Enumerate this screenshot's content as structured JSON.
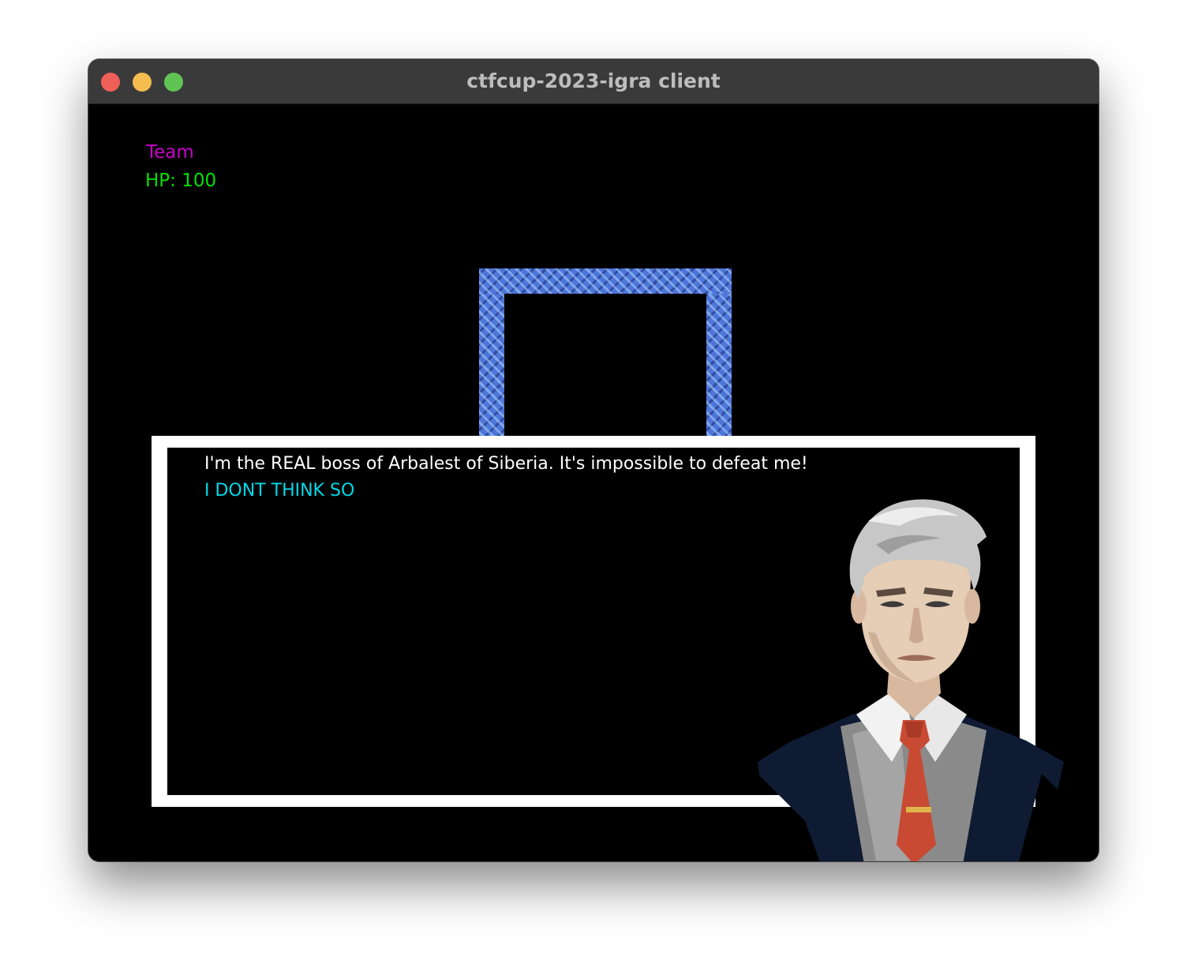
{
  "window": {
    "title": "ctfcup-2023-igra client"
  },
  "hud": {
    "team_label": "Team",
    "hp_text": "HP: 100",
    "team_color": "#c800c8",
    "hp_color": "#00e000"
  },
  "dialog": {
    "message": "I'm the REAL boss of Arbalest of Siberia. It's impossible to defeat me!",
    "response": "I DONT THINK SO",
    "message_color": "#ffffff",
    "response_color": "#00d8e8"
  },
  "scene": {
    "wall_color": "#4e76d8",
    "portrait": "boss-portrait-gray-haired-man-red-tie"
  }
}
